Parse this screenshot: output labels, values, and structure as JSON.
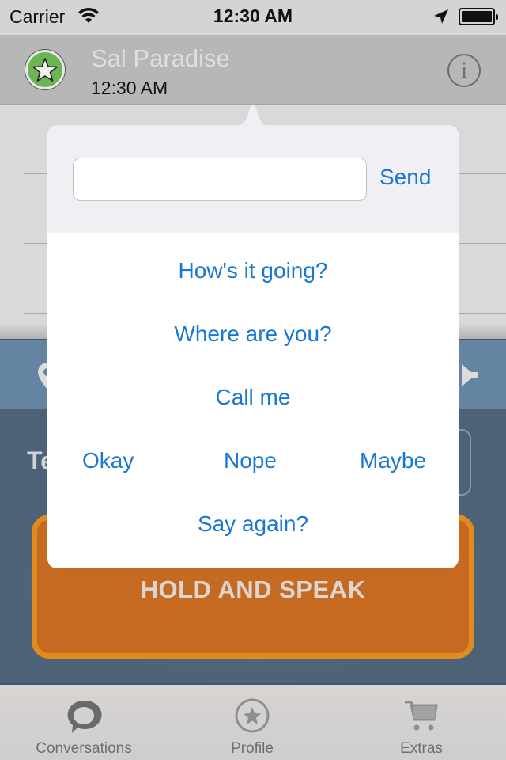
{
  "status_bar": {
    "carrier": "Carrier",
    "time": "12:30 AM",
    "battery_level": 1.0
  },
  "header": {
    "contact_name": "Sal Paradise",
    "timestamp": "12:30 AM",
    "avatar_icon": "star-icon",
    "info_icon": "info-icon",
    "info_glyph": "i"
  },
  "background": {
    "partial_label": "Te",
    "hold_button_label": "HOLD AND SPEAK",
    "toolbar_icons": [
      "location-pin-icon",
      "speaker-icon"
    ]
  },
  "popover": {
    "message_input": {
      "value": "",
      "placeholder": ""
    },
    "send_label": "Send",
    "quick_replies": {
      "row1": "How's it going?",
      "row2": "Where are you?",
      "row3": "Call me",
      "row4": [
        "Okay",
        "Nope",
        "Maybe"
      ],
      "row5": "Say again?"
    }
  },
  "tabbar": {
    "tabs": [
      {
        "label": "Conversations",
        "icon": "speech-bubble-icon"
      },
      {
        "label": "Profile",
        "icon": "star-circle-icon"
      },
      {
        "label": "Extras",
        "icon": "cart-icon"
      }
    ]
  },
  "colors": {
    "accent_blue": "#1877d4",
    "hold_button": "#c66a22",
    "hold_button_border": "#df8b1f",
    "toolbar": "#6584a2",
    "lower_bg": "#4d6277",
    "avatar_green": "#6cb553"
  }
}
